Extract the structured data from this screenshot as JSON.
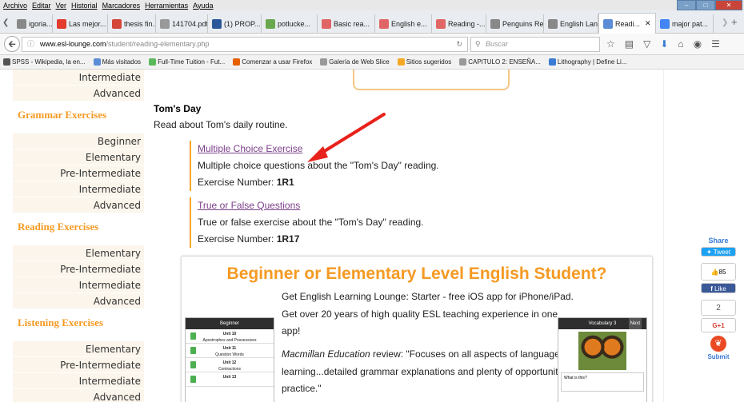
{
  "menu": [
    "Archivo",
    "Editar",
    "Ver",
    "Historial",
    "Marcadores",
    "Herramientas",
    "Ayuda"
  ],
  "window": {
    "min": "–",
    "max": "□",
    "close": "✕"
  },
  "tabs": [
    {
      "label": "igoria...",
      "icon_color": "#888888"
    },
    {
      "label": "Las mejor...",
      "icon_color": "#e33b2e"
    },
    {
      "label": "thesis fin...",
      "icon_color": "#d44638"
    },
    {
      "label": "141704.pdf",
      "icon_color": "#999999"
    },
    {
      "label": "(1) PROP...",
      "icon_color": "#2b579a"
    },
    {
      "label": "potlucke...",
      "icon_color": "#6aa84f"
    },
    {
      "label": "Basic rea...",
      "icon_color": "#e06666"
    },
    {
      "label": "English e...",
      "icon_color": "#e06666"
    },
    {
      "label": "Reading -...",
      "icon_color": "#e06666"
    },
    {
      "label": "Penguins Rea...",
      "icon_color": "#888888"
    },
    {
      "label": "English Lang...",
      "icon_color": "#888888"
    },
    {
      "label": "Readi...",
      "icon_color": "#5b8dd6",
      "active": true
    },
    {
      "label": "major pat...",
      "icon_color": "#4285f4"
    }
  ],
  "url": {
    "domain": "www.esl-lounge.com",
    "path": "/student/reading-elementary.php"
  },
  "search_placeholder": "Buscar",
  "bookmarks": [
    {
      "label": "SPSS - Wikipedia, la en...",
      "icon_color": "#555555"
    },
    {
      "label": "Más visitados",
      "icon_color": "#5b8dd6"
    },
    {
      "label": "Full-Time Tuition - Fut...",
      "icon_color": "#5cb85c"
    },
    {
      "label": "Comenzar a usar Firefox",
      "icon_color": "#e66000"
    },
    {
      "label": "Galería de Web Slice",
      "icon_color": "#999999"
    },
    {
      "label": "Sitios sugeridos",
      "icon_color": "#f5a623"
    },
    {
      "label": "CAPITULO 2: ENSEÑA...",
      "icon_color": "#999999"
    },
    {
      "label": "Lithography | Define Li...",
      "icon_color": "#3a7bd5"
    }
  ],
  "sidebar": {
    "top_items": [
      "Intermediate",
      "Advanced"
    ],
    "grammar": {
      "heading": "Grammar Exercises",
      "items": [
        "Beginner",
        "Elementary",
        "Pre-Intermediate",
        "Intermediate",
        "Advanced"
      ]
    },
    "reading": {
      "heading": "Reading Exercises",
      "items": [
        "Elementary",
        "Pre-Intermediate",
        "Intermediate",
        "Advanced"
      ]
    },
    "listening": {
      "heading": "Listening Exercises",
      "items": [
        "Elementary",
        "Pre-Intermediate",
        "Intermediate",
        "Advanced"
      ]
    }
  },
  "main": {
    "title": "Tom's Day",
    "desc": "Read about Tom's daily routine.",
    "exercises": [
      {
        "link": "Multiple Choice Exercise",
        "desc": "Multiple choice questions about the \"Tom's Day\" reading.",
        "num_label": "Exercise Number:",
        "num": "1R1"
      },
      {
        "link": "True or False Questions",
        "desc": "True or false exercise about the \"Tom's Day\" reading.",
        "num_label": "Exercise Number:",
        "num": "1R17"
      }
    ]
  },
  "promo": {
    "heading": "Beginner or Elementary Level English Student?",
    "p1": "Get English Learning Lounge: Starter - free iOS app for iPhone/iPad. Get over 20 years of high quality ESL teaching experience in one app!",
    "p2_em": "Macmillan Education",
    "p2": " review: \"Focuses on all aspects of language learning...detailed grammar explanations and plenty of opportunity to practice.\"",
    "phone_left": {
      "header": "Beginner",
      "units": [
        {
          "t": "Unit 10",
          "s": "Apostrophes and Possessives"
        },
        {
          "t": "Unit 11",
          "s": "Question Words"
        },
        {
          "t": "Unit 12",
          "s": "Contractions"
        },
        {
          "t": "Unit 13",
          "s": ""
        }
      ]
    },
    "phone_right": {
      "header": "Vocabulary 3",
      "next": "Next",
      "question": "What is this?"
    }
  },
  "share": {
    "title": "Share",
    "tweet": "Tweet",
    "likes": "85",
    "like": "Like",
    "plus_count": "2",
    "gplus": "G+1",
    "submit": "Submit"
  }
}
